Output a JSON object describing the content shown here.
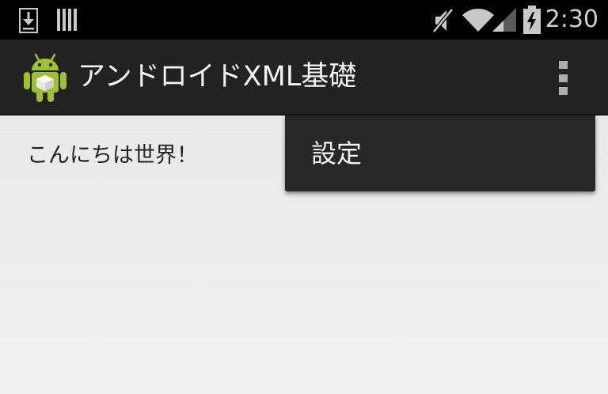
{
  "status_bar": {
    "time": "2:30",
    "left_icons": [
      "download-notification-icon",
      "barcode-notification-icon"
    ],
    "right_icons": [
      "mute-icon",
      "wifi-icon",
      "cell-signal-icon",
      "battery-charging-icon"
    ]
  },
  "action_bar": {
    "title": "アンドロイドXML基礎",
    "logo_icon": "android-app-icon",
    "overflow_icon": "overflow-menu-icon"
  },
  "content": {
    "hello_text": "こんにちは世界！"
  },
  "overflow_menu": {
    "items": [
      {
        "label": "設定"
      }
    ]
  },
  "colors": {
    "status_bar": "#000000",
    "action_bar": "#222222",
    "content_background": "#ececec",
    "menu_background": "#282828",
    "android_green": "#9fc130"
  }
}
